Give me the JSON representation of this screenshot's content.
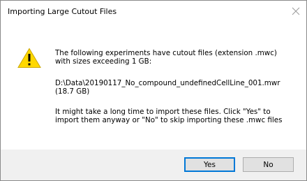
{
  "dialog": {
    "title": "Importing Large Cutout Files",
    "close_icon": "close-icon",
    "warning_icon": "warning-triangle-icon",
    "message": {
      "line1": "The following experiments have cutout files (extension .mwc)",
      "line2": "with sizes exceeding 1 GB:",
      "file_path": "D:\\Data\\20190117_No_compound_undefinedCellLine_001.mwr",
      "file_size": "(18.7 GB)",
      "line5": "It might take a long time to import these files. Click \"Yes\" to",
      "line6": "import them anyway or \"No\" to skip importing these .mwc files"
    },
    "buttons": {
      "yes_label": "Yes",
      "no_label": "No"
    }
  },
  "colors": {
    "focus_border": "#0078d7",
    "footer_bg": "#f0f0f0",
    "warning_yellow": "#ffd800"
  }
}
